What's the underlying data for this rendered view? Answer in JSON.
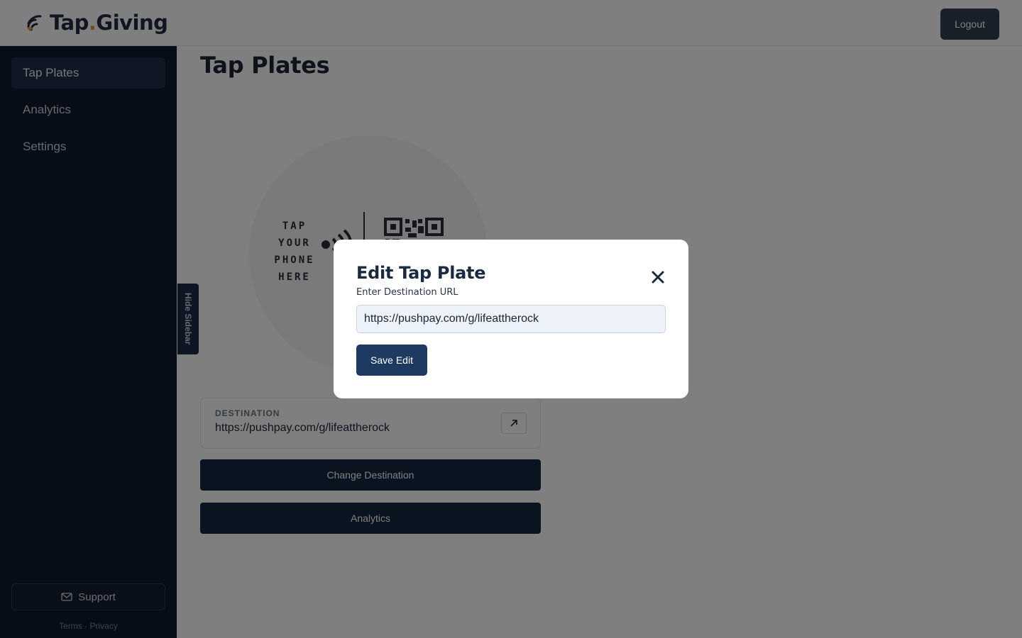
{
  "header": {
    "brand_prefix": "Tap",
    "brand_dot": ".",
    "brand_suffix": "Giving",
    "logout_label": "Logout",
    "logo_icon": "nfc-wave-icon",
    "accent_color": "#e0a33a"
  },
  "sidebar": {
    "items": [
      {
        "label": "Tap Plates",
        "active": true
      },
      {
        "label": "Analytics",
        "active": false
      },
      {
        "label": "Settings",
        "active": false
      }
    ],
    "support_label": "Support",
    "support_icon": "mail-icon",
    "terms_label": "Terms",
    "separator": "·",
    "privacy_label": "Privacy",
    "hide_sidebar_label": "Hide Sidebar"
  },
  "main": {
    "page_title": "Tap Plates",
    "plate": {
      "line1": "TAP",
      "line2": "YOUR",
      "line3": "PHONE",
      "line4": "HERE"
    },
    "destination": {
      "label": "DESTINATION",
      "url": "https://pushpay.com/g/lifeattherock",
      "open_icon": "external-link-icon"
    },
    "change_destination_label": "Change Destination",
    "analytics_label": "Analytics"
  },
  "modal": {
    "title": "Edit Tap Plate",
    "close_icon": "close-icon",
    "field_label": "Enter Destination URL",
    "field_value": "https://pushpay.com/g/lifeattherock",
    "save_label": "Save Edit"
  }
}
